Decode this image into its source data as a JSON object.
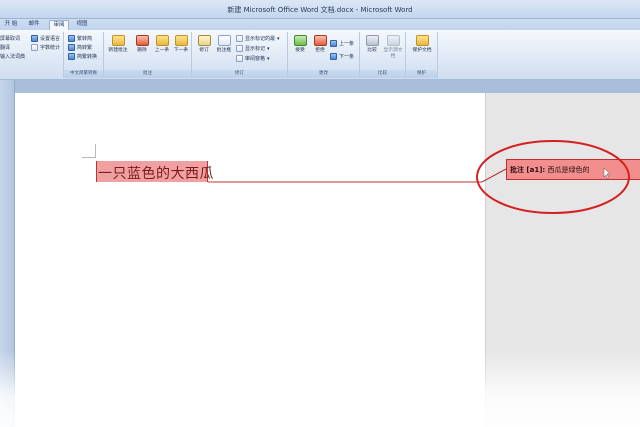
{
  "window": {
    "title": "新建 Microsoft Office Word 文档.docx - Microsoft Word"
  },
  "tabs": [
    {
      "label": "开 始",
      "active": false
    },
    {
      "label": "邮件",
      "active": false
    },
    {
      "label": "审阅",
      "active": true
    },
    {
      "label": "视图",
      "active": false
    }
  ],
  "ribbon": {
    "proofing": {
      "items": [
        "屏幕取词",
        "翻译",
        "输入法词典"
      ],
      "set_language": "设置语言",
      "word_count": "字数统计"
    },
    "chinese_conversion": {
      "label": "中文简繁转换",
      "items": [
        "繁转简",
        "简转繁",
        "简繁转换"
      ]
    },
    "comments": {
      "label": "批注",
      "new_comment": "新建批注",
      "delete": "删除",
      "previous": "上一条",
      "next": "下一条"
    },
    "tracking": {
      "label": "修订",
      "track_changes": "修订",
      "balloons": "批注框",
      "show_markup_final": "显示标记的最",
      "show_markup": "显示标记",
      "reviewing_pane": "审阅窗格"
    },
    "changes": {
      "label": "更改",
      "accept": "接受",
      "reject": "拒绝",
      "previous": "上一条",
      "next": "下一条"
    },
    "compare": {
      "label": "比较",
      "compare": "比较",
      "show_source": "显示源文档"
    },
    "protect": {
      "label": "保护",
      "protect_document": "保护文档"
    }
  },
  "document": {
    "body_text": "一只蓝色的大西瓜"
  },
  "comment": {
    "prefix": "批注 [a1]:",
    "text": "西瓜是绿色的"
  },
  "colors": {
    "highlight": "#f0a0a0",
    "comment_fill": "#f28e8e",
    "annotation_red": "#d42020"
  }
}
